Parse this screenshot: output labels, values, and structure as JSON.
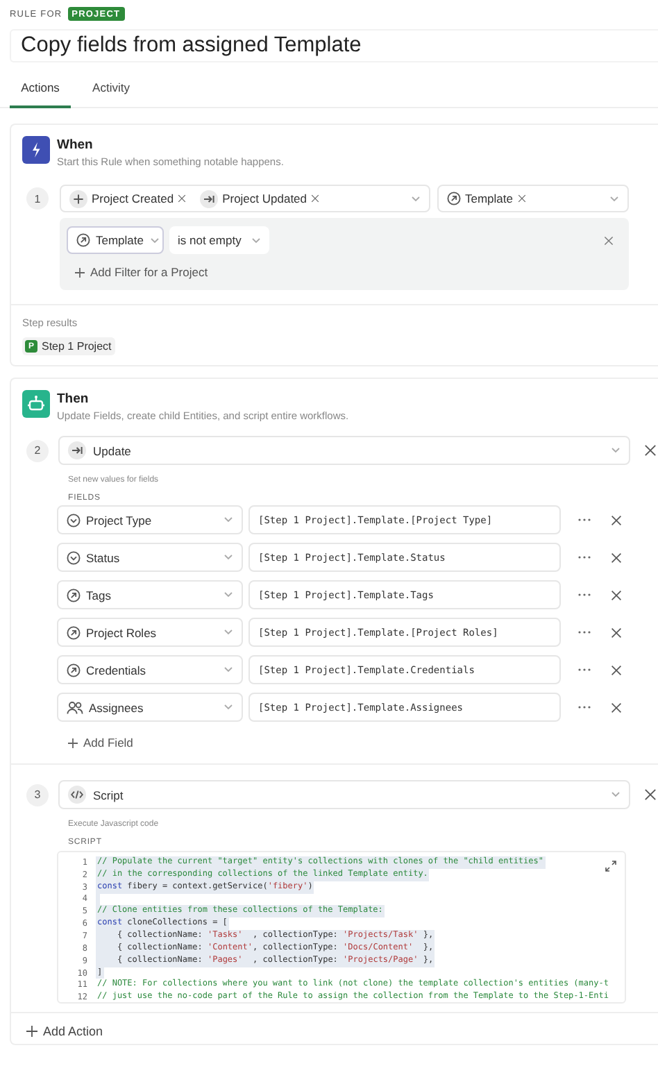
{
  "header": {
    "label": "RULE FOR",
    "badge": "PROJECT",
    "title": "Copy fields from assigned Template"
  },
  "tabs": [
    {
      "label": "Actions",
      "selected": true
    },
    {
      "label": "Activity",
      "selected": false
    }
  ],
  "when": {
    "title": "When",
    "subtitle": "Start this Rule when something notable happens.",
    "number": "1",
    "triggers": [
      {
        "kind": "created",
        "label": "Project Created"
      },
      {
        "kind": "updated",
        "label": "Project Updated"
      }
    ],
    "fields": [
      {
        "kind": "relation",
        "label": "Template"
      }
    ],
    "filter": {
      "field": {
        "kind": "relation",
        "label": "Template"
      },
      "operator": "is not empty",
      "add": "Add Filter for a Project"
    }
  },
  "step_results": {
    "label": "Step results",
    "chips": [
      {
        "badge": "P",
        "label": "Step 1 Project"
      }
    ]
  },
  "then": {
    "title": "Then",
    "subtitle": "Update Fields, create child Entities, and script entire workflows.",
    "actions": [
      {
        "kind": "update",
        "number": "2",
        "label": "Update",
        "description": "Set new values for fields",
        "section": "FIELDS",
        "add": "Add Field",
        "fields": [
          {
            "kind": "select",
            "name": "Project Type",
            "value": "[Step 1 Project].Template.[Project Type]"
          },
          {
            "kind": "select",
            "name": "Status",
            "value": "[Step 1 Project].Template.Status"
          },
          {
            "kind": "relation",
            "name": "Tags",
            "value": "[Step 1 Project].Template.Tags"
          },
          {
            "kind": "relation",
            "name": "Project Roles",
            "value": "[Step 1 Project].Template.[Project Roles]"
          },
          {
            "kind": "relation",
            "name": "Credentials",
            "value": "[Step 1 Project].Template.Credentials"
          },
          {
            "kind": "people",
            "name": "Assignees",
            "value": "[Step 1 Project].Template.Assignees"
          }
        ]
      },
      {
        "kind": "script",
        "number": "3",
        "label": "Script",
        "description": "Execute Javascript code",
        "section": "SCRIPT",
        "lines": [
          {
            "number": "1",
            "selected": true,
            "tokens": [
              {
                "kind": "comment",
                "text": "// Populate the current \"target\" entity's collections with clones of the \"child entities\""
              }
            ]
          },
          {
            "number": "2",
            "selected": true,
            "tokens": [
              {
                "kind": "comment",
                "text": "// in the corresponding collections of the linked Template entity."
              }
            ]
          },
          {
            "number": "3",
            "selected": true,
            "tokens": [
              {
                "kind": "keyword",
                "text": "const"
              },
              {
                "kind": "plain",
                "text": " fibery = context.getService("
              },
              {
                "kind": "string",
                "text": "'fibery'"
              },
              {
                "kind": "plain",
                "text": ")"
              }
            ]
          },
          {
            "number": "4",
            "selected": true
          },
          {
            "number": "5",
            "selected": true,
            "tokens": [
              {
                "kind": "comment",
                "text": "// Clone entities from these collections of the Template:"
              }
            ]
          },
          {
            "number": "6",
            "selected": true,
            "tokens": [
              {
                "kind": "keyword",
                "text": "const"
              },
              {
                "kind": "plain",
                "text": " cloneCollections = ["
              }
            ]
          },
          {
            "number": "7",
            "selected": true,
            "tokens": [
              {
                "kind": "plain",
                "text": "    { collectionName: "
              },
              {
                "kind": "string",
                "text": "'Tasks'"
              },
              {
                "kind": "plain",
                "text": "  , collectionType: "
              },
              {
                "kind": "string",
                "text": "'Projects/Task'"
              },
              {
                "kind": "plain",
                "text": " },"
              }
            ]
          },
          {
            "number": "8",
            "selected": true,
            "tokens": [
              {
                "kind": "plain",
                "text": "    { collectionName: "
              },
              {
                "kind": "string",
                "text": "'Content'"
              },
              {
                "kind": "plain",
                "text": ", collectionType: "
              },
              {
                "kind": "string",
                "text": "'Docs/Content'"
              },
              {
                "kind": "plain",
                "text": "  },"
              }
            ]
          },
          {
            "number": "9",
            "selected": true,
            "tokens": [
              {
                "kind": "plain",
                "text": "    { collectionName: "
              },
              {
                "kind": "string",
                "text": "'Pages'"
              },
              {
                "kind": "plain",
                "text": "  , collectionType: "
              },
              {
                "kind": "string",
                "text": "'Projects/Page'"
              },
              {
                "kind": "plain",
                "text": " },"
              }
            ]
          },
          {
            "number": "10",
            "selected": true,
            "tokens": [
              {
                "kind": "plain",
                "text": "]"
              }
            ]
          },
          {
            "number": "11",
            "selected": false,
            "tokens": [
              {
                "kind": "comment",
                "text": "// NOTE: For collections where you want to link (not clone) the template collection's entities (many-t"
              }
            ]
          },
          {
            "number": "12",
            "selected": false,
            "tokens": [
              {
                "kind": "comment",
                "text": "// just use the no-code part of the Rule to assign the collection from the Template to the Step-1-Enti"
              }
            ]
          }
        ]
      }
    ],
    "add_action": "Add Action"
  }
}
